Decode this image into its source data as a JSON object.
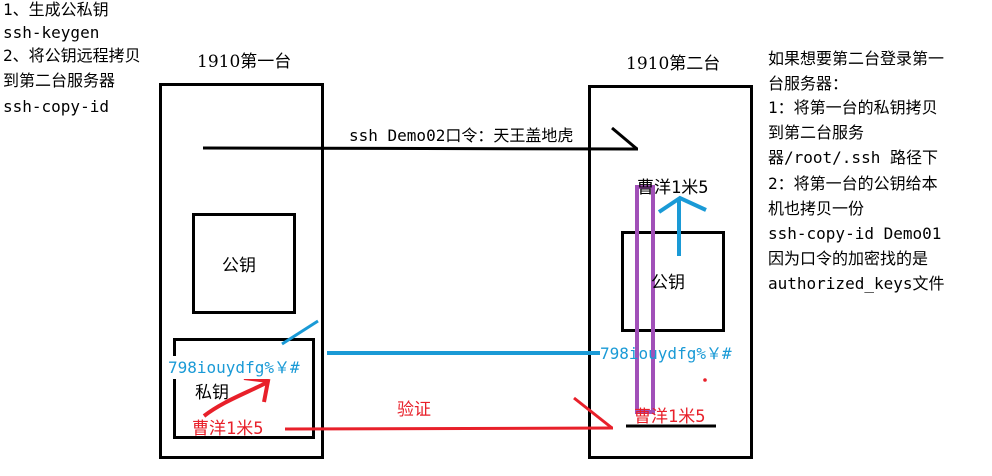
{
  "colors": {
    "ink": "#000000",
    "blue": "#1a9ad6",
    "red": "#e8202a",
    "purple": "#a150b8"
  },
  "left_notes": [
    "1、生成公私钥",
    "ssh-keygen",
    "2、将公钥远程拷贝",
    "到第二台服务器",
    "ssh-copy-id"
  ],
  "server1": {
    "title": "1910第一台",
    "public_key_label": "公钥",
    "private_key_label": "私钥",
    "key_string": "798iouydfg%￥#",
    "verify_text": "曹洋1米5"
  },
  "server2": {
    "title": "1910第二台",
    "public_key_label": "公钥",
    "key_string": "798iouydfg%￥#",
    "top_text": "曹洋1米5",
    "bottom_text": "曹洋1米5"
  },
  "ssh_command": "ssh Demo02口令：天王盖地虎",
  "verify_label": "验证",
  "right_notes": [
    "如果想要第二台登录第一",
    "台服务器：",
    "1：将第一台的私钥拷贝",
    "到第二台服务",
    "器/root/.ssh 路径下",
    "2：将第一台的公钥给本",
    "机也拷贝一份",
    "ssh-copy-id Demo01",
    "因为口令的加密找的是",
    "authorized_keys文件"
  ]
}
